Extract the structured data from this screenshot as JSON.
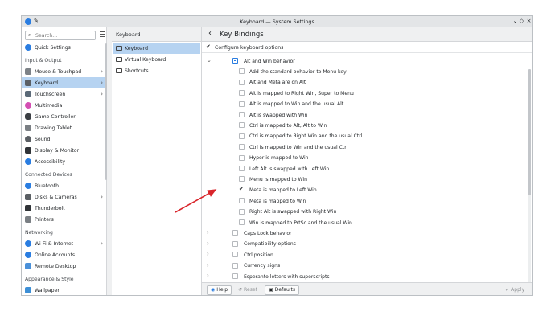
{
  "window": {
    "title": "Keyboard — System Settings",
    "controls": [
      "⌄",
      "◇",
      "×"
    ]
  },
  "sidebar": {
    "search_placeholder": "Search...",
    "quick_settings": "Quick Settings",
    "sections": [
      {
        "header": "Input & Output",
        "items": [
          {
            "label": "Mouse & Touchpad",
            "chevron": true,
            "icon_color": "#7d8287"
          },
          {
            "label": "Keyboard",
            "chevron": true,
            "active": true,
            "icon_color": "#5a5f64"
          },
          {
            "label": "Touchscreen",
            "chevron": true,
            "icon_color": "#5b6a78"
          },
          {
            "label": "Multimedia",
            "chevron": false,
            "icon_color": "#d44fb3"
          },
          {
            "label": "Game Controller",
            "chevron": false,
            "icon_color": "#3b3f44"
          },
          {
            "label": "Drawing Tablet",
            "chevron": false,
            "icon_color": "#7a7f84"
          },
          {
            "label": "Sound",
            "chevron": false,
            "icon_color": "#5a5f64"
          },
          {
            "label": "Display & Monitor",
            "chevron": false,
            "icon_color": "#2f3337"
          },
          {
            "label": "Accessibility",
            "chevron": false,
            "icon_color": "#2a7de1"
          }
        ]
      },
      {
        "header": "Connected Devices",
        "items": [
          {
            "label": "Bluetooth",
            "chevron": false,
            "icon_color": "#2a7de1"
          },
          {
            "label": "Disks & Cameras",
            "chevron": true,
            "icon_color": "#5a5f64"
          },
          {
            "label": "Thunderbolt",
            "chevron": false,
            "icon_color": "#2f3337"
          },
          {
            "label": "Printers",
            "chevron": false,
            "icon_color": "#7a7f84"
          }
        ]
      },
      {
        "header": "Networking",
        "items": [
          {
            "label": "Wi-Fi & Internet",
            "chevron": true,
            "icon_color": "#2a7de1"
          },
          {
            "label": "Online Accounts",
            "chevron": false,
            "icon_color": "#2a7de1"
          },
          {
            "label": "Remote Desktop",
            "chevron": false,
            "icon_color": "#4a90d9"
          }
        ]
      },
      {
        "header": "Appearance & Style",
        "items": [
          {
            "label": "Wallpaper",
            "chevron": false,
            "icon_color": "#3d8fd6"
          }
        ]
      }
    ]
  },
  "keyboard_panel": {
    "title": "Keyboard",
    "items": [
      {
        "label": "Keyboard",
        "active": true
      },
      {
        "label": "Virtual Keyboard",
        "active": false
      },
      {
        "label": "Shortcuts",
        "active": false
      }
    ]
  },
  "bindings_panel": {
    "title": "Key Bindings",
    "configure_label": "Configure keyboard options",
    "configure_checked": true,
    "group_expanded": "Alt and Win behavior",
    "options": [
      {
        "label": "Add the standard behavior to Menu key",
        "checked": false
      },
      {
        "label": "Alt and Meta are on Alt",
        "checked": false
      },
      {
        "label": "Alt is mapped to Right Win, Super to Menu",
        "checked": false
      },
      {
        "label": "Alt is mapped to Win and the usual Alt",
        "checked": false
      },
      {
        "label": "Alt is swapped with Win",
        "checked": false
      },
      {
        "label": "Ctrl is mapped to Alt, Alt to Win",
        "checked": false
      },
      {
        "label": "Ctrl is mapped to Right Win and the usual Ctrl",
        "checked": false
      },
      {
        "label": "Ctrl is mapped to Win and the usual Ctrl",
        "checked": false
      },
      {
        "label": "Hyper is mapped to Win",
        "checked": false
      },
      {
        "label": "Left Alt is swapped with Left Win",
        "checked": false
      },
      {
        "label": "Menu is mapped to Win",
        "checked": false
      },
      {
        "label": "Meta is mapped to Left Win",
        "checked": true
      },
      {
        "label": "Meta is mapped to Win",
        "checked": false
      },
      {
        "label": "Right Alt is swapped with Right Win",
        "checked": false
      },
      {
        "label": "Win is mapped to PrtSc and the usual Win",
        "checked": false
      }
    ],
    "groups": [
      "Caps Lock behavior",
      "Compatibility options",
      "Ctrl position",
      "Currency signs",
      "Esperanto letters with superscripts"
    ]
  },
  "footer": {
    "help": "Help",
    "reset": "Reset",
    "defaults": "Defaults",
    "apply": "Apply"
  },
  "colors": {
    "accent": "#2a7de1",
    "selection": "#b6d3f1",
    "annotation_arrow": "#d9252b"
  }
}
